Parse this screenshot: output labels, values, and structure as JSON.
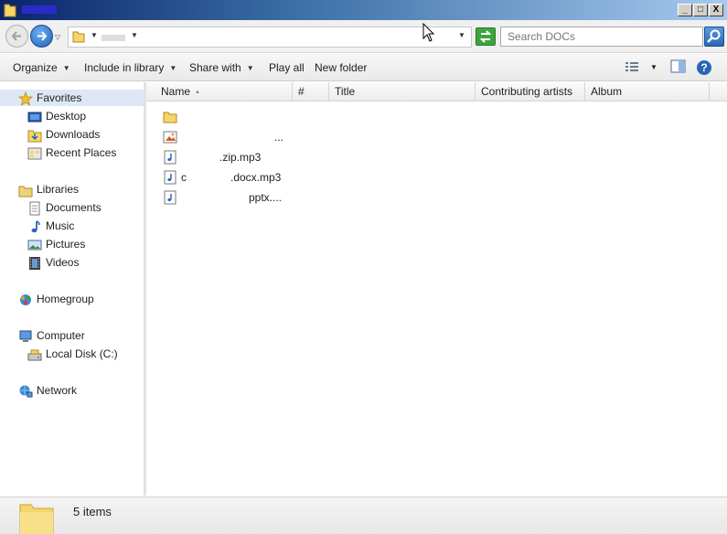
{
  "window": {
    "title": "",
    "controls": [
      "_",
      "□",
      "X"
    ]
  },
  "nav": {
    "back_icon": "back-arrow-icon",
    "forward_icon": "forward-arrow-icon"
  },
  "address": {
    "path_segment": ""
  },
  "search": {
    "placeholder": "Search DOCs"
  },
  "toolbar": {
    "organize": "Organize",
    "include_in_library": "Include in library",
    "share_with": "Share with",
    "play_all": "Play all",
    "new_folder": "New folder"
  },
  "sidebar": {
    "favorites": "Favorites",
    "favorites_items": [
      "Desktop",
      "Downloads",
      "Recent Places"
    ],
    "libraries": "Libraries",
    "libraries_items": [
      "Documents",
      "Music",
      "Pictures",
      "Videos"
    ],
    "homegroup": "Homegroup",
    "computer": "Computer",
    "computer_items": [
      "Local Disk (C:)"
    ],
    "network": "Network"
  },
  "columns": {
    "name": "Name",
    "number": "#",
    "title": "Title",
    "artists": "Contributing artists",
    "album": "Album"
  },
  "files": [
    {
      "type": "folder-icon",
      "name_prefix": "",
      "name_suffix": ""
    },
    {
      "type": "picture-file-icon",
      "name_prefix": "",
      "name_suffix": "..."
    },
    {
      "type": "audio-file-icon",
      "name_prefix": "",
      "name_suffix": ".zip.mp3"
    },
    {
      "type": "audio-file-icon",
      "name_prefix": "c",
      "name_suffix": ".docx.mp3"
    },
    {
      "type": "audio-file-icon",
      "name_prefix": "",
      "name_suffix": "pptx...."
    }
  ],
  "status": {
    "item_count": "5 items"
  },
  "colors": {
    "title_gradient_start": "#0a246a",
    "selection": "#dde8f5",
    "accent_blue": "#1f5fb8"
  }
}
